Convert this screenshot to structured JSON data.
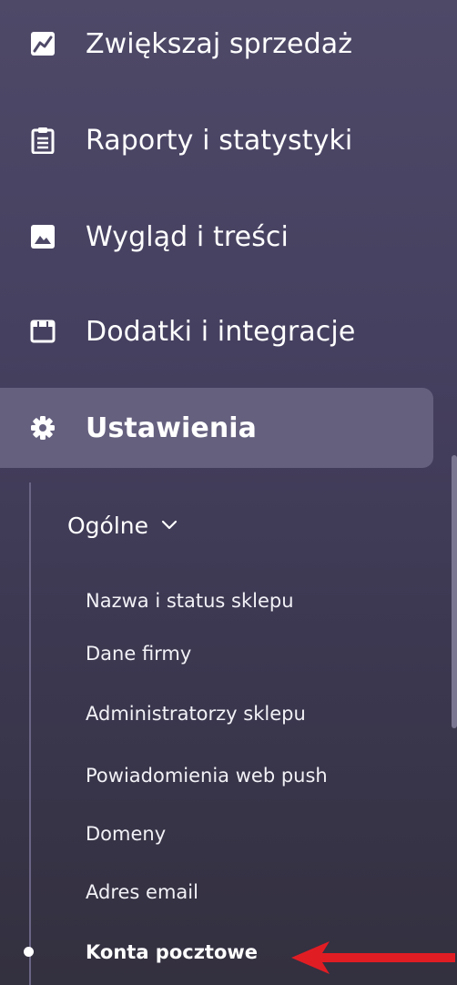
{
  "sidebar": {
    "items": [
      {
        "label": "Zwiększaj sprzedaż",
        "icon": "trending-up-icon"
      },
      {
        "label": "Raporty i statystyki",
        "icon": "clipboard-icon"
      },
      {
        "label": "Wygląd i treści",
        "icon": "image-icon"
      },
      {
        "label": "Dodatki i integracje",
        "icon": "window-icon"
      },
      {
        "label": "Ustawienia",
        "icon": "gear-icon",
        "active": true
      }
    ],
    "group": {
      "label": "Ogólne",
      "icon": "chevron-down-icon",
      "expanded": true
    },
    "sub_items": [
      {
        "label": "Nazwa i status sklepu"
      },
      {
        "label": "Dane firmy"
      },
      {
        "label": "Administratorzy sklepu"
      },
      {
        "label": "Powiadomienia web push"
      },
      {
        "label": "Domeny"
      },
      {
        "label": "Adres email"
      },
      {
        "label": "Konta pocztowe",
        "active": true
      }
    ]
  },
  "annotation": {
    "icon": "red-arrow-icon",
    "color": "#e11d24"
  },
  "colors": {
    "background_top": "#4f4968",
    "background_bottom": "#33303f",
    "active_item": "#66607f"
  }
}
